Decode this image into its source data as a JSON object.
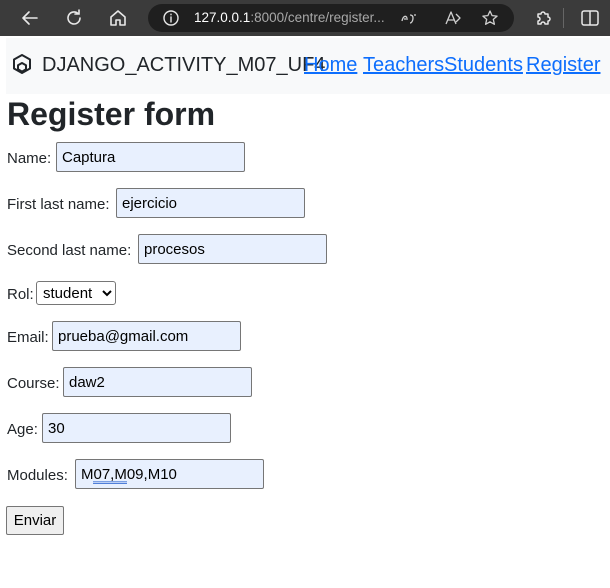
{
  "browser": {
    "url_host": "127.0.0.1",
    "url_rest": ":8000/centre/register..."
  },
  "navbar": {
    "brand": "DJANGO_ACTIVITY_M07_UF4",
    "links": [
      "Home",
      "Teachers",
      "Students",
      "Register"
    ]
  },
  "form": {
    "title": "Register form",
    "name": {
      "label": "Name:",
      "value": "Captura"
    },
    "first_last_name": {
      "label": "First last name:",
      "value": "ejercicio"
    },
    "second_last_name": {
      "label": "Second last name:",
      "value": "procesos"
    },
    "rol": {
      "label": "Rol:",
      "selected": "student"
    },
    "email": {
      "label": "Email:",
      "value": "prueba@gmail.com"
    },
    "course": {
      "label": "Course:",
      "value": "daw2"
    },
    "age": {
      "label": "Age:",
      "value": "30"
    },
    "modules": {
      "label": "Modules:",
      "value": "M07,M09,M10"
    },
    "submit_label": "Enviar"
  },
  "colors": {
    "chrome_background": "#3b3b3b",
    "navbar_background": "#f8f9fa",
    "link": "#0d6efd",
    "autofill_background": "#e8f0fe"
  },
  "icons": [
    "back-icon",
    "reload-icon",
    "home-icon",
    "info-icon",
    "read-aloud-icon",
    "text-size-icon",
    "favorite-star-icon",
    "extensions-icon",
    "split-screen-icon",
    "django-logo-icon"
  ]
}
